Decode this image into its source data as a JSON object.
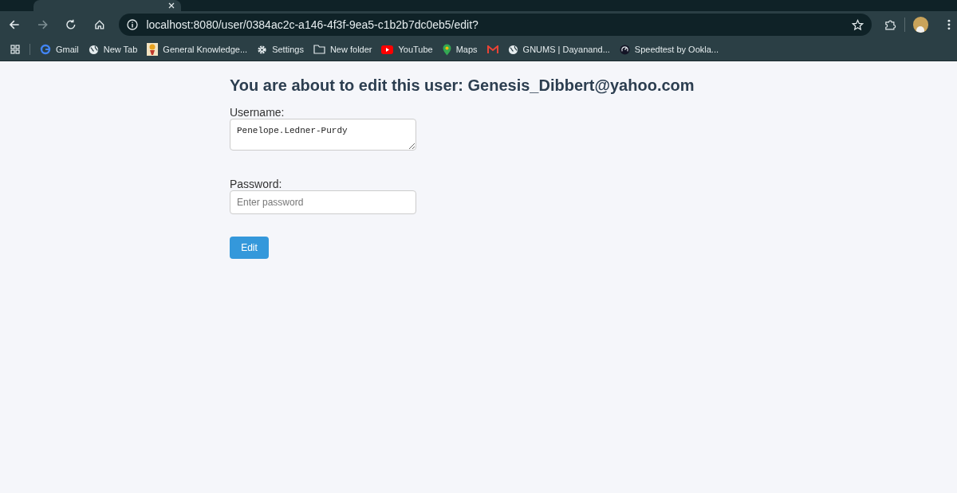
{
  "browser": {
    "url": "localhost:8080/user/0384ac2c-a146-4f3f-9ea5-c1b2b7dc0eb5/edit?",
    "bookmarks": [
      {
        "kind": "google",
        "label": "Gmail"
      },
      {
        "kind": "globe",
        "label": "New Tab"
      },
      {
        "kind": "image",
        "label": "General Knowledge..."
      },
      {
        "kind": "gear",
        "label": "Settings"
      },
      {
        "kind": "folder",
        "label": "New folder"
      },
      {
        "kind": "play",
        "label": "YouTube"
      },
      {
        "kind": "pin",
        "label": "Maps"
      },
      {
        "kind": "mail"
      },
      {
        "kind": "globe",
        "label": "GNUMS | Dayanand..."
      },
      {
        "kind": "gauge",
        "label": "Speedtest by Ookla..."
      }
    ]
  },
  "page": {
    "heading": "You are about to edit this user: Genesis_Dibbert@yahoo.com",
    "username_label": "Username:",
    "username_value": "Penelope.Ledner-Purdy",
    "password_label": "Password:",
    "password_placeholder": "Enter password",
    "submit": "Edit"
  }
}
